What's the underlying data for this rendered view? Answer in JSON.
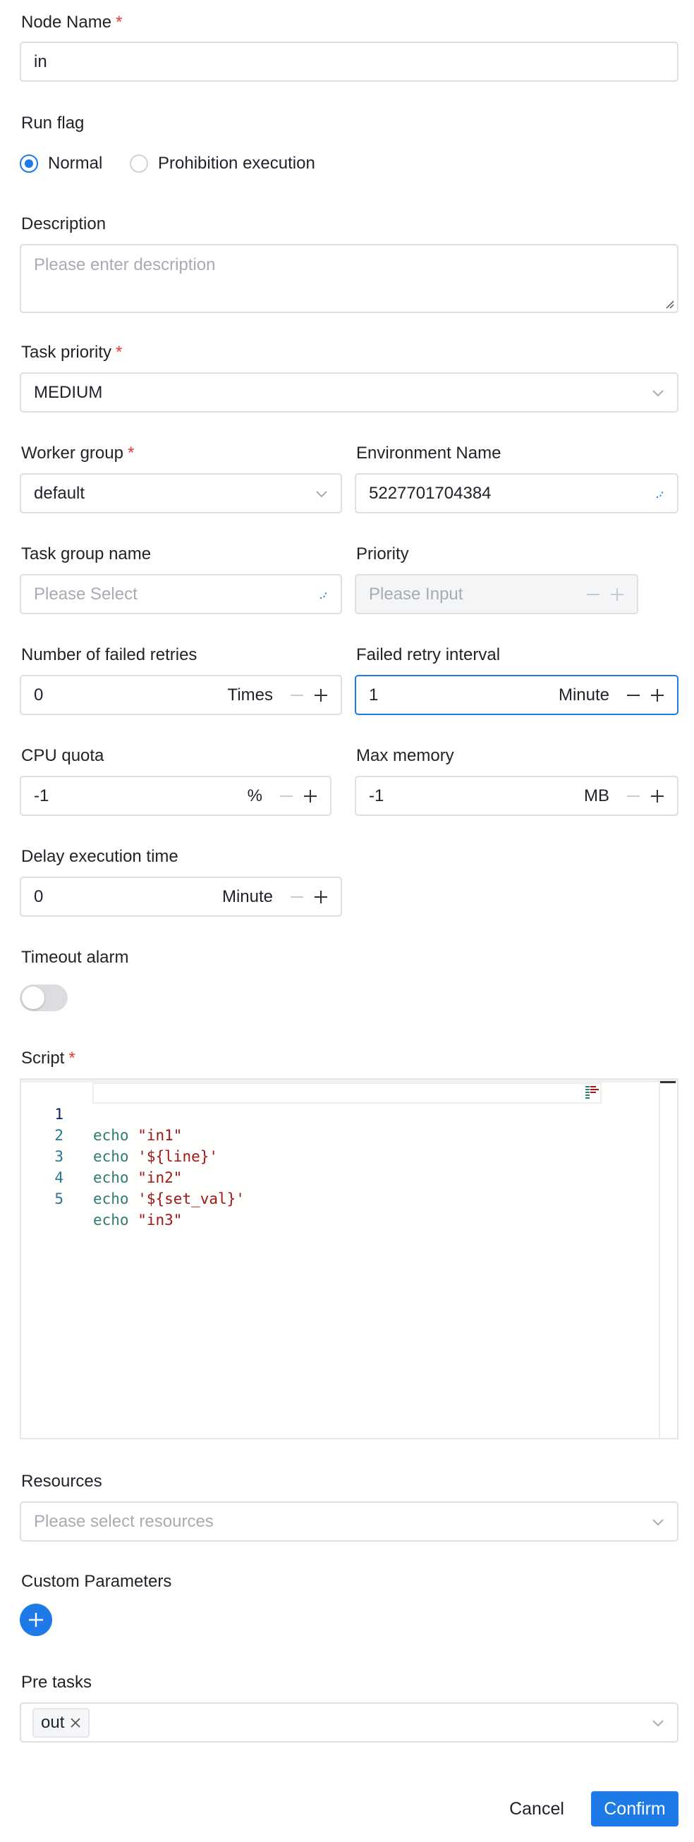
{
  "node_name": {
    "label": "Node Name",
    "required": "*",
    "value": "in"
  },
  "run_flag": {
    "label": "Run flag",
    "options": [
      "Normal",
      "Prohibition execution"
    ],
    "selected": "Normal"
  },
  "description": {
    "label": "Description",
    "placeholder": "Please enter description"
  },
  "task_priority": {
    "label": "Task priority",
    "required": "*",
    "value": "MEDIUM"
  },
  "worker_group": {
    "label": "Worker group",
    "required": "*",
    "value": "default"
  },
  "environment_name": {
    "label": "Environment Name",
    "value": "5227701704384"
  },
  "task_group_name": {
    "label": "Task group name",
    "placeholder": "Please Select"
  },
  "priority": {
    "label": "Priority",
    "placeholder": "Please Input"
  },
  "failed_retries": {
    "label": "Number of failed retries",
    "value": "0",
    "unit": "Times"
  },
  "failed_retry_interval": {
    "label": "Failed retry interval",
    "value": "1",
    "unit": "Minute"
  },
  "cpu_quota": {
    "label": "CPU quota",
    "value": "-1",
    "unit": "%"
  },
  "max_memory": {
    "label": "Max memory",
    "value": "-1",
    "unit": "MB"
  },
  "delay_execution_time": {
    "label": "Delay execution time",
    "value": "0",
    "unit": "Minute"
  },
  "timeout_alarm": {
    "label": "Timeout alarm",
    "enabled": false
  },
  "script": {
    "label": "Script",
    "required": "*",
    "lines": [
      {
        "num": "1",
        "kw": "echo",
        "str": "\"in1\""
      },
      {
        "num": "2",
        "kw": "echo",
        "str": "'${line}'"
      },
      {
        "num": "3",
        "kw": "echo",
        "str": "\"in2\""
      },
      {
        "num": "4",
        "kw": "echo",
        "str": "'${set_val}'"
      },
      {
        "num": "5",
        "kw": "echo",
        "str": "\"in3\""
      }
    ]
  },
  "resources": {
    "label": "Resources",
    "placeholder": "Please select resources"
  },
  "custom_parameters": {
    "label": "Custom Parameters"
  },
  "pre_tasks": {
    "label": "Pre tasks",
    "tags": [
      "out"
    ]
  },
  "footer": {
    "cancel": "Cancel",
    "confirm": "Confirm"
  },
  "colors": {
    "primary": "#1e7ae6",
    "required": "#e53935",
    "border": "#dcdfe6"
  }
}
